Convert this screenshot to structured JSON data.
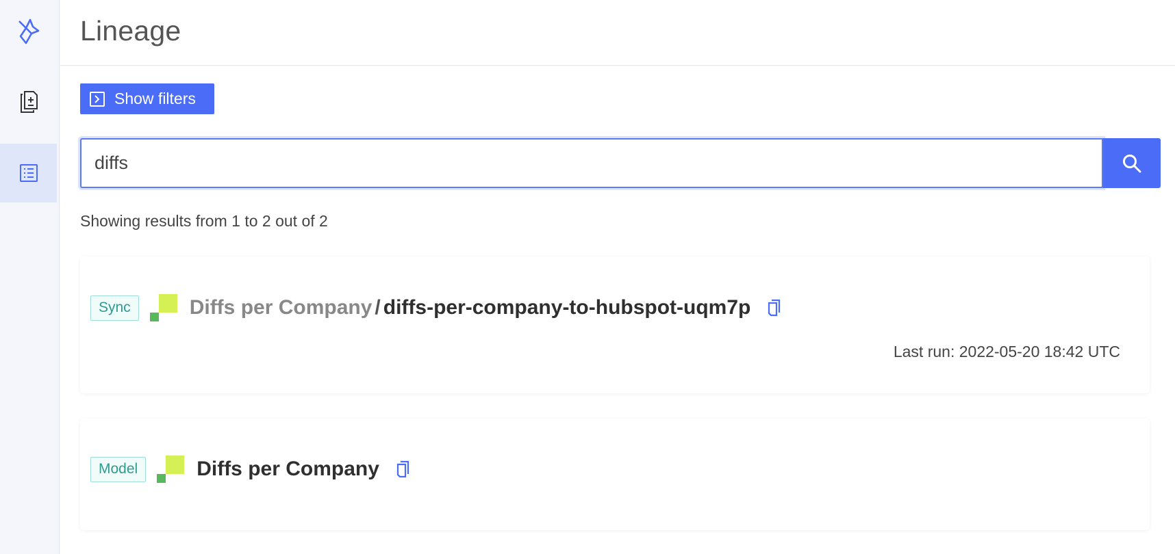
{
  "header": {
    "title": "Lineage"
  },
  "sidebar": {
    "items": [
      {
        "name": "logo",
        "icon": "origami-bird-logo-icon",
        "active": false
      },
      {
        "name": "models",
        "icon": "document-diff-icon",
        "active": false
      },
      {
        "name": "lineage",
        "icon": "list-icon",
        "active": true
      }
    ]
  },
  "filters": {
    "button_label": "Show filters",
    "icon": "chevron-right-box-icon"
  },
  "search": {
    "value": "diffs",
    "button_icon": "search-icon"
  },
  "results": {
    "summary": "Showing results from 1 to 2 out of 2",
    "items": [
      {
        "type_label": "Sync",
        "parent_name": "Diffs per Company",
        "separator": "/",
        "name": "diffs-per-company-to-hubspot-uqm7p",
        "last_run": "Last run: 2022-05-20 18:42 UTC"
      },
      {
        "type_label": "Model",
        "name": "Diffs per Company"
      }
    ]
  },
  "colors": {
    "accent": "#4a6cf7",
    "tag_text": "#2f9a8f",
    "tag_border": "#9fdfd8",
    "logo_light": "#d4f054",
    "logo_dark": "#5ab85c"
  }
}
